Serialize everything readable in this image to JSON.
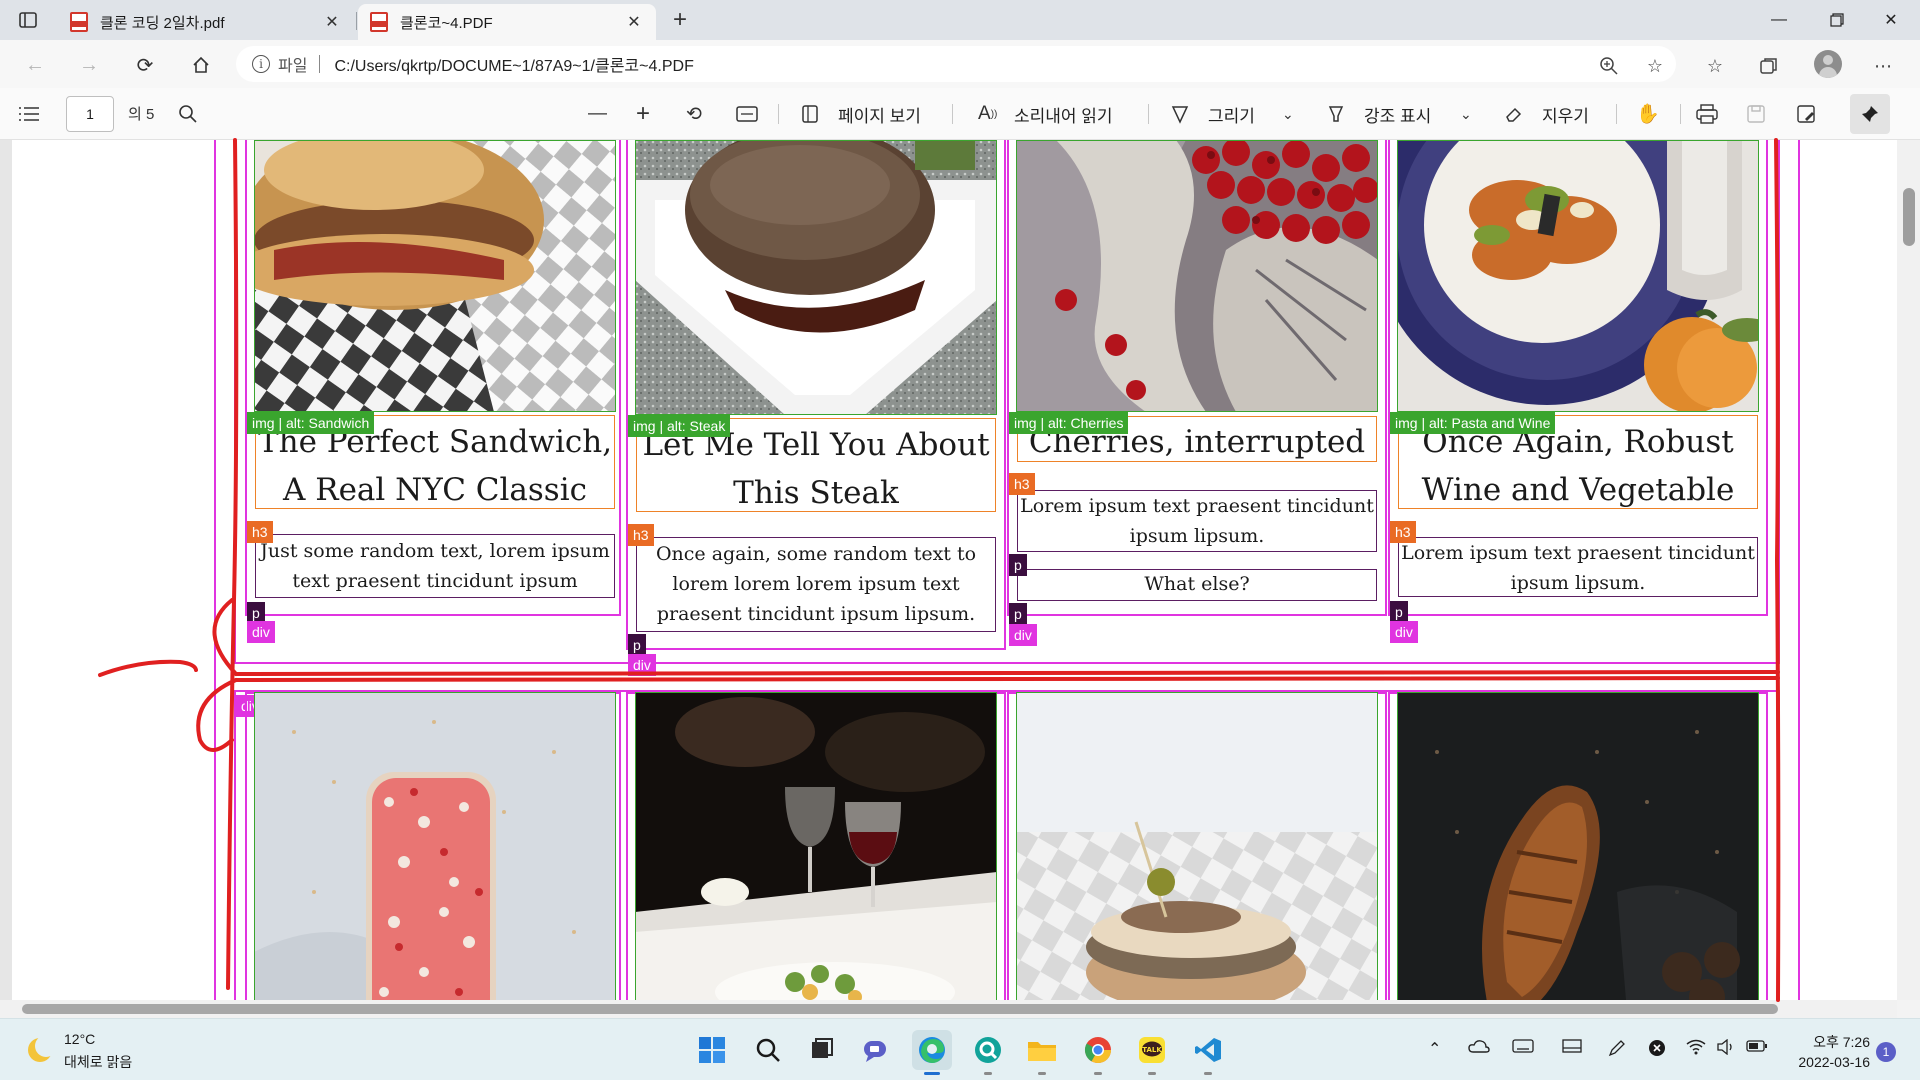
{
  "browser": {
    "tabs": [
      {
        "title": "클론 코딩 2일차.pdf",
        "active": false
      },
      {
        "title": "클론코~4.PDF",
        "active": true
      }
    ],
    "address": {
      "label": "파일",
      "url": "C:/Users/qkrtp/DOCUME~1/87A9~1/클론코~4.PDF"
    }
  },
  "pdf_toolbar": {
    "page_current": "1",
    "page_total": "의 5",
    "page_view": "페이지 보기",
    "read_aloud": "소리내어 읽기",
    "draw": "그리기",
    "highlight": "강조 표시",
    "erase": "지우기"
  },
  "cards": [
    {
      "img_tag": "img | alt: Sandwich",
      "title": "The Perfect Sandwich, A Real NYC Classic",
      "h3_tag": "h3",
      "texts": [
        "Just some random text, lorem ipsum text praesent tincidunt ipsum lipsum."
      ],
      "p_tag": "p",
      "div_tag": "div"
    },
    {
      "img_tag": "img | alt: Steak",
      "title": "Let Me Tell You About This Steak",
      "h3_tag": "h3",
      "texts": [
        "Once again, some random text to lorem lorem lorem ipsum text praesent tincidunt ipsum lipsum."
      ],
      "p_tag": "p",
      "div_tag": "div"
    },
    {
      "img_tag": "img | alt: Cherries",
      "title": "Cherries, interrupted",
      "h3_tag": "h3",
      "texts": [
        "Lorem ipsum text praesent tincidunt ipsum lipsum.",
        "What else?"
      ],
      "p_tag": "p",
      "div_tag": "div"
    },
    {
      "img_tag": "img | alt: Pasta and Wine",
      "title": "Once Again, Robust Wine and Vegetable Pasta",
      "h3_tag": "h3",
      "texts": [
        "Lorem ipsum text praesent tincidunt ipsum lipsum."
      ],
      "p_tag": "p",
      "div_tag": "div"
    }
  ],
  "row2_div_tag": "div",
  "taskbar": {
    "weather_temp": "12°C",
    "weather_desc": "대체로 맑음",
    "time": "오후 7:26",
    "date": "2022-03-16",
    "notifications": "1"
  },
  "colors": {
    "div_outline": "#e034e0",
    "img_outline": "#3aa52e",
    "h3_outline": "#ee8228",
    "p_outline": "#5b1e62",
    "pen_annotation": "#e02020"
  }
}
